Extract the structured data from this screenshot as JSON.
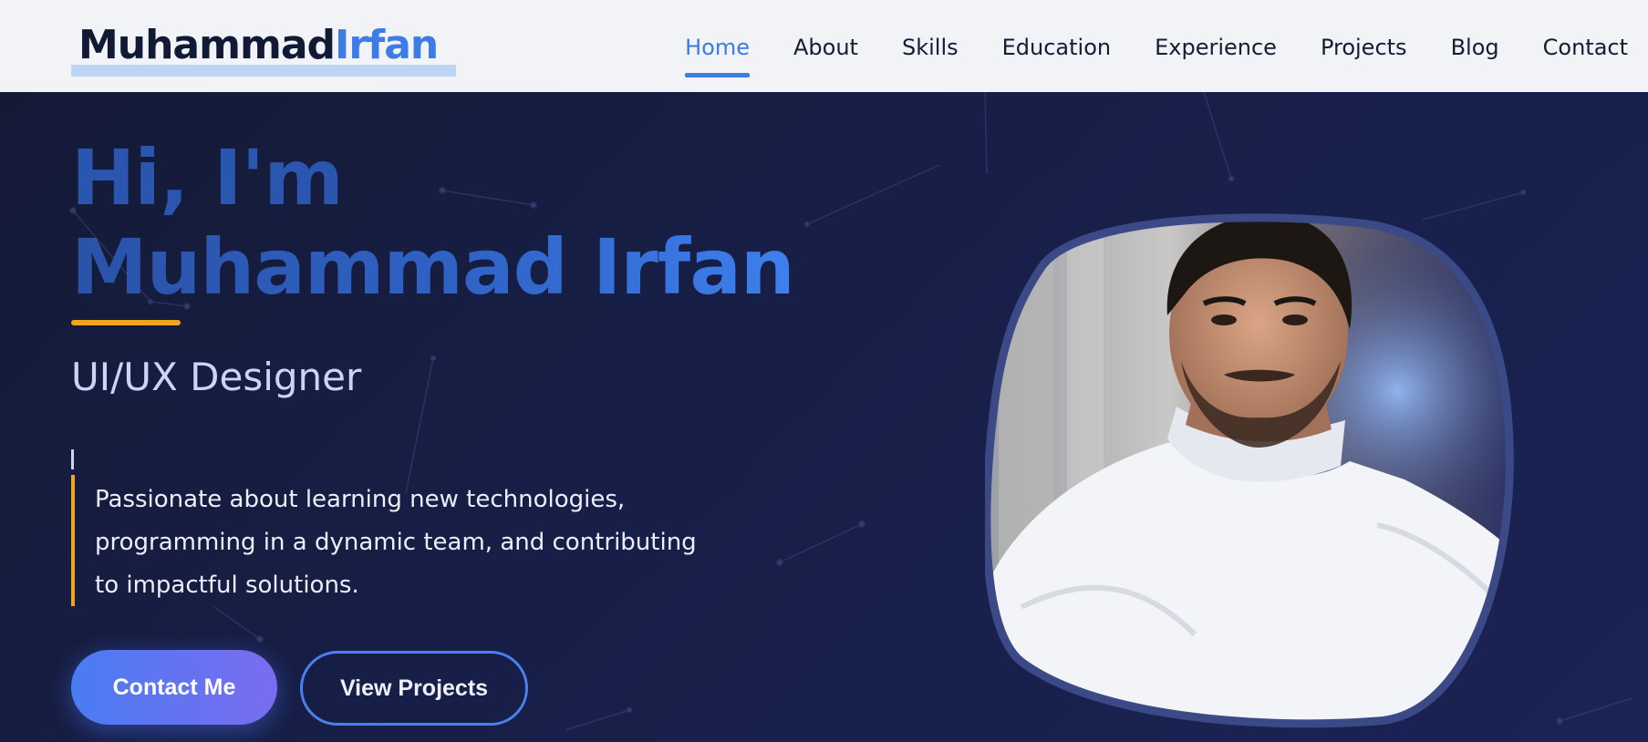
{
  "header": {
    "logo_first": "Muhammad",
    "logo_second": "Irfan",
    "nav": [
      {
        "label": "Home",
        "active": true
      },
      {
        "label": "About",
        "active": false
      },
      {
        "label": "Skills",
        "active": false
      },
      {
        "label": "Education",
        "active": false
      },
      {
        "label": "Experience",
        "active": false
      },
      {
        "label": "Projects",
        "active": false
      },
      {
        "label": "Blog",
        "active": false
      },
      {
        "label": "Contact",
        "active": false
      }
    ]
  },
  "hero": {
    "greeting": "Hi, I'm",
    "name": "Muhammad Irfan",
    "role": "UI/UX Designer",
    "description": [
      "Passionate about learning new technologies,",
      "programming in a dynamic team, and contributing",
      "to impactful solutions."
    ],
    "primary_button": "Contact Me",
    "secondary_button": "View Projects"
  },
  "colors": {
    "accent_blue": "#3d7be6",
    "accent_orange": "#f2a51b",
    "hero_background": "#171f45",
    "header_background": "#f2f3f6"
  }
}
